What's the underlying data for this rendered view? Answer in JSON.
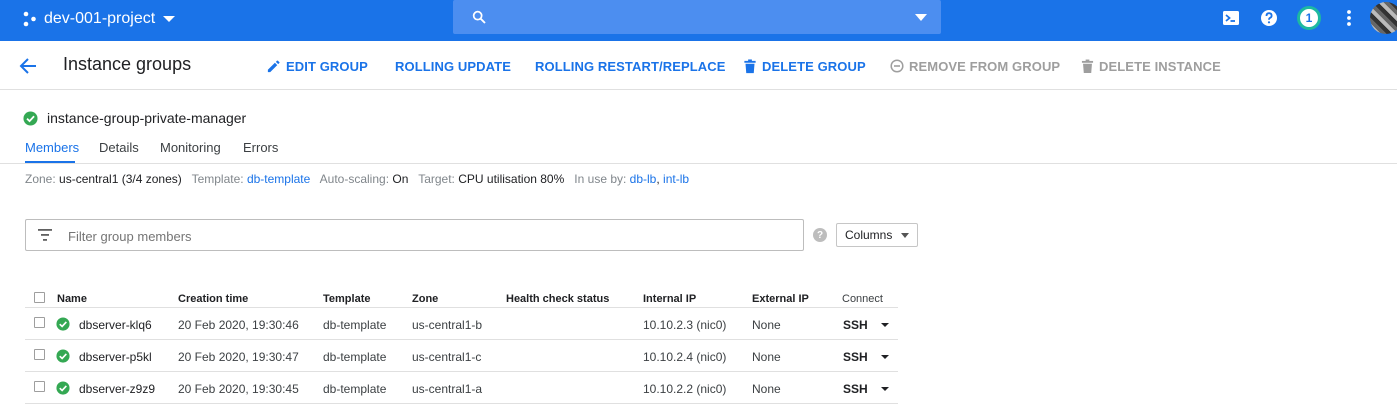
{
  "topbar": {
    "project": "dev-001-project",
    "notifications": "1",
    "icons": [
      "project-icon",
      "search-icon",
      "cloud-shell-icon",
      "help-icon",
      "more-vert-icon"
    ]
  },
  "header": {
    "title": "Instance groups",
    "actions": {
      "edit": "EDIT GROUP",
      "rolling_update": "ROLLING UPDATE",
      "rolling_restart": "ROLLING RESTART/REPLACE",
      "delete_group": "DELETE GROUP",
      "remove_from_group": "REMOVE FROM GROUP",
      "delete_instance": "DELETE INSTANCE"
    }
  },
  "group": {
    "name": "instance-group-private-manager",
    "tabs": [
      "Members",
      "Details",
      "Monitoring",
      "Errors"
    ],
    "active_tab": "Members"
  },
  "info": {
    "zone_label": "Zone:",
    "zone_value": "us-central1 (3/4 zones)",
    "template_label": "Template:",
    "template_value": "db-template",
    "autoscaling_label": "Auto-scaling:",
    "autoscaling_value": "On",
    "target_label": "Target:",
    "target_value": "CPU utilisation 80%",
    "inuse_label": "In use by:",
    "inuse_1": "db-lb",
    "inuse_sep": ",",
    "inuse_2": "int-lb"
  },
  "filter": {
    "placeholder": "Filter group members",
    "columns_label": "Columns",
    "help": "?"
  },
  "table": {
    "headers": {
      "name": "Name",
      "creation": "Creation time",
      "template": "Template",
      "zone": "Zone",
      "health": "Health check status",
      "internal_ip": "Internal IP",
      "external_ip": "External IP",
      "connect": "Connect"
    },
    "rows": [
      {
        "name": "dbserver-klq6",
        "creation": "20 Feb 2020, 19:30:46",
        "template": "db-template",
        "zone": "us-central1-b",
        "health": "",
        "internal_ip": "10.10.2.3 (nic0)",
        "external_ip": "None",
        "connect": "SSH"
      },
      {
        "name": "dbserver-p5kl",
        "creation": "20 Feb 2020, 19:30:47",
        "template": "db-template",
        "zone": "us-central1-c",
        "health": "",
        "internal_ip": "10.10.2.4 (nic0)",
        "external_ip": "None",
        "connect": "SSH"
      },
      {
        "name": "dbserver-z9z9",
        "creation": "20 Feb 2020, 19:30:45",
        "template": "db-template",
        "zone": "us-central1-a",
        "health": "",
        "internal_ip": "10.10.2.2 (nic0)",
        "external_ip": "None",
        "connect": "SSH"
      }
    ]
  },
  "colors": {
    "topbar": "#1a73e8",
    "accent": "#1a73e8",
    "ok_green": "#34a853",
    "disabled": "#9e9e9e"
  }
}
